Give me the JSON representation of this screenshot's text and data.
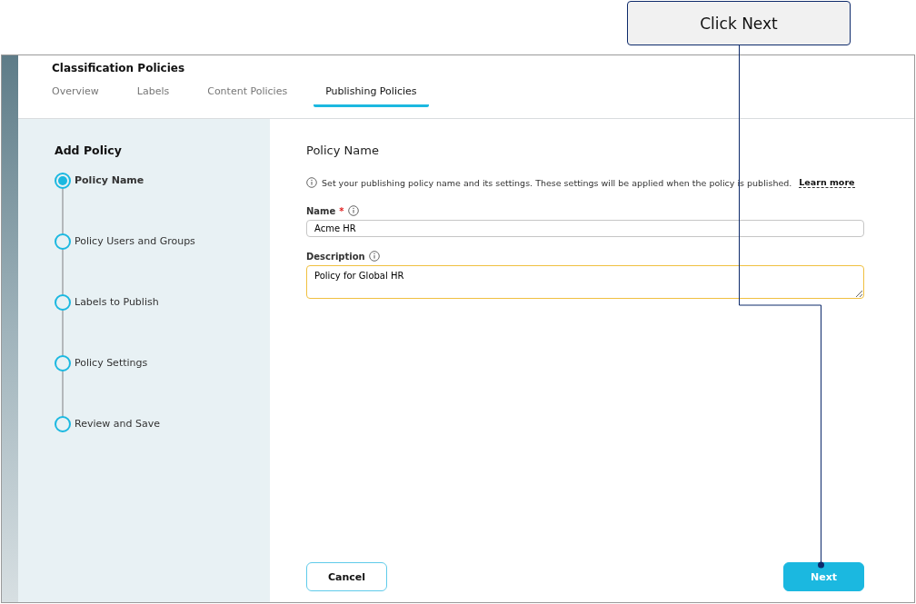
{
  "callout": {
    "text": "Click Next"
  },
  "header": {
    "title": "Classification Policies"
  },
  "tabs": [
    {
      "label": "Overview",
      "selected": false
    },
    {
      "label": "Labels",
      "selected": false
    },
    {
      "label": "Content Policies",
      "selected": false
    },
    {
      "label": "Publishing Policies",
      "selected": true
    }
  ],
  "sidebar": {
    "title": "Add Policy",
    "steps": [
      {
        "label": "Policy Name",
        "selected": true
      },
      {
        "label": "Policy Users and Groups",
        "selected": false
      },
      {
        "label": "Labels to Publish",
        "selected": false
      },
      {
        "label": "Policy Settings",
        "selected": false
      },
      {
        "label": "Review and Save",
        "selected": false
      }
    ]
  },
  "form": {
    "heading": "Policy Name",
    "info": "Set your publishing policy name and its settings. These settings will be applied when the policy is published.",
    "info_link": "Learn more",
    "fields": [
      {
        "label": "Name",
        "required": true,
        "required_mark": "*",
        "value": "Acme HR",
        "kind": "input",
        "focused": false
      },
      {
        "label": "Description",
        "value": "Policy for Global HR",
        "kind": "textarea",
        "focused": true
      }
    ]
  },
  "buttons": [
    {
      "label": "Cancel",
      "kind": "secondary"
    },
    {
      "label": "Next",
      "kind": "primary"
    }
  ]
}
